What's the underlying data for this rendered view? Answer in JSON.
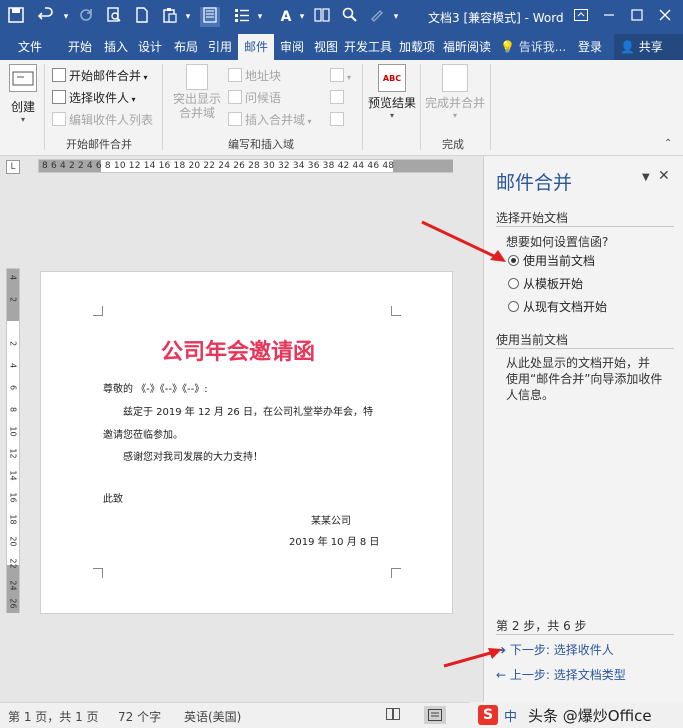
{
  "titlebar": {
    "document_title": "文档3 [兼容模式] - Word",
    "icons": [
      "save-icon",
      "undo-icon",
      "redo-icon",
      "print-preview-icon",
      "new-icon",
      "paste-icon",
      "touch-mode-icon",
      "bullets-icon",
      "font-color-icon",
      "columns-icon",
      "find-icon",
      "format-painter-icon",
      "customize-icon"
    ]
  },
  "tabs": [
    "文件",
    "开始",
    "插入",
    "设计",
    "布局",
    "引用",
    "邮件",
    "审阅",
    "视图",
    "开发工具",
    "加载项",
    "福昕阅读"
  ],
  "active_tab": "邮件",
  "tell_me": "告诉我...",
  "login": "登录",
  "share": "共享",
  "ribbon": {
    "create": {
      "label": "创建"
    },
    "start_merge": {
      "start_label": "开始邮件合并",
      "select_label": "选择收件人",
      "edit_label": "编辑收件人列表",
      "group_label": "开始邮件合并"
    },
    "write_insert": {
      "highlight_label": "突出显示\n合并域",
      "address_label": "地址块",
      "greeting_label": "问候语",
      "insert_field_label": "插入合并域",
      "group_label": "编写和插入域"
    },
    "preview": {
      "icon_text": "ABC",
      "label": "预览结果"
    },
    "finish": {
      "label": "完成并合并",
      "group_label": "完成"
    }
  },
  "ruler": {
    "corner": "L",
    "horizontal": "8  6  4  2     2  4  6  8  10 12 14 16 18 20 22 24 26 28 30 32 34 36 38      42 44 46 48",
    "vertical": [
      "4",
      "2",
      "2",
      "4",
      "6",
      "8",
      "10",
      "12",
      "14",
      "16",
      "18",
      "20",
      "22",
      "24",
      "26",
      "28"
    ]
  },
  "document": {
    "heading": "公司年会邀请函",
    "salutation": "尊敬的 《-》《--》《--》:",
    "body1": "兹定于 2019 年 12 月 26 日，在公司礼堂举办年会，特",
    "body2": "邀请您莅临参加。",
    "body3": "感谢您对我司发展的大力支持！",
    "closing": "此致",
    "sender": "某某公司",
    "date": "2019 年 10 月 8 日"
  },
  "pane": {
    "title": "邮件合并",
    "section1": "选择开始文档",
    "question": "想要如何设置信函?",
    "options": [
      "使用当前文档",
      "从模板开始",
      "从现有文档开始"
    ],
    "selected_option": "使用当前文档",
    "section2": "使用当前文档",
    "desc_lines": [
      "从此处显示的文档开始，并",
      "使用“邮件合并”向导添加收件",
      "人信息。"
    ],
    "step": "第 2 步，共 6 步",
    "next": "下一步: 选择收件人",
    "prev": "上一步: 选择文档类型"
  },
  "statusbar": {
    "page": "第 1 页，共 1 页",
    "words": "72 个字",
    "lang": "英语(美国)"
  },
  "watermark": "头条 @爆炒Office",
  "colors": {
    "ribbon_blue": "#2b579a",
    "heading_pink": "#e8355a",
    "arrow_red": "#e02020"
  }
}
